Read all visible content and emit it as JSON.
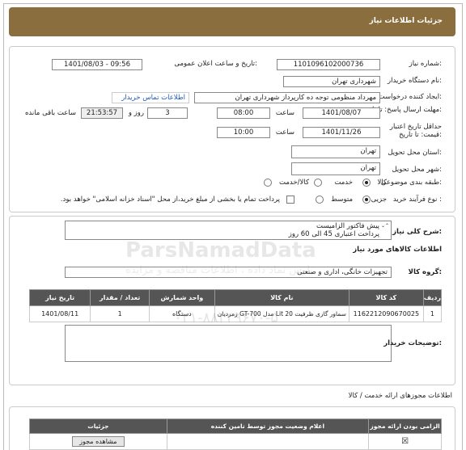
{
  "header": {
    "title": "جزئیات اطلاعات نیاز"
  },
  "form": {
    "need_number_label": "شماره نیاز:",
    "need_number": "1101096102000736",
    "announce_label": "تاریخ و ساعت اعلان عمومی:",
    "announce_value": "1401/08/03 - 09:56",
    "buyer_org_label": "نام دستگاه خریدار:",
    "buyer_org": "شهرداری تهران",
    "creator_label": "ایجاد کننده درخواست:",
    "creator": "مهرداد منظومی توجه ده کارپرداز شهرداری تهران",
    "contact_link": "اطلاعات تماس خریدار",
    "send_deadline_label": "مهلت ارسال پاسخ: تا تاریخ:",
    "send_date": "1401/08/07",
    "time_label": "ساعت",
    "send_time": "08:00",
    "days": "3",
    "days_label": "روز و",
    "remaining": "21:53:57",
    "remaining_label": "ساعت باقی مانده",
    "price_deadline_label": "حداقل تاریخ اعتبار قیمت: تا تاریخ:",
    "price_date": "1401/11/26",
    "price_time": "10:00",
    "province_label": "استان محل تحویل:",
    "province": "تهران",
    "city_label": "شهر محل تحویل:",
    "city": "تهران",
    "category_label": "طبقه بندی موضوعی:",
    "category_options": [
      "کالا",
      "خدمت",
      "کالا/خدمت"
    ],
    "process_label": "نوع فرآیند خرید :",
    "process_options": [
      "جزیی",
      "متوسط"
    ],
    "payment_note": "پرداخت تمام یا بخشی از مبلغ خرید،از محل \"اسناد خزانه اسلامی\" خواهد بود."
  },
  "need": {
    "summary_label": "شرح کلی نیاز:",
    "summary_line1": "پیش فاکتور الزامیست",
    "summary_line2": "پرداخت اعتباری 45 الی 60 روز",
    "goods_info_title": "اطلاعات کالاهای مورد نیاز",
    "group_label": "گروه کالا:",
    "group_value": "تجهیزات خانگی، اداری و صنعتی",
    "table_headers": [
      "ردیف",
      "کد کالا",
      "نام کالا",
      "واحد شمارش",
      "تعداد / مقدار",
      "تاریخ نیاز"
    ],
    "rows": [
      [
        "1",
        "1162212090670025",
        "سماور گازی ظرفیت 20 Lit مدل GT-700 زمردیان",
        "دستگاه",
        "1",
        "1401/08/11"
      ]
    ],
    "buyer_notes_label": "توضیحات خریدار:"
  },
  "watermark": {
    "line1": "ParsNamadData",
    "line2": "پارس نماد داده ، اطلاعات مناقصه و مزایده",
    "line3": "۰۲۱-۸۸۳۴۹۶۷۰-۵"
  },
  "services": {
    "title": "اطلاعات مجوزهای ارائه خدمت / کالا",
    "headers": [
      "الزامی بودن ارائه مجوز",
      "اعلام وضعیت مجوز توسط تامین کننده",
      "جزئیات"
    ],
    "view_button": "مشاهده مجوز"
  }
}
